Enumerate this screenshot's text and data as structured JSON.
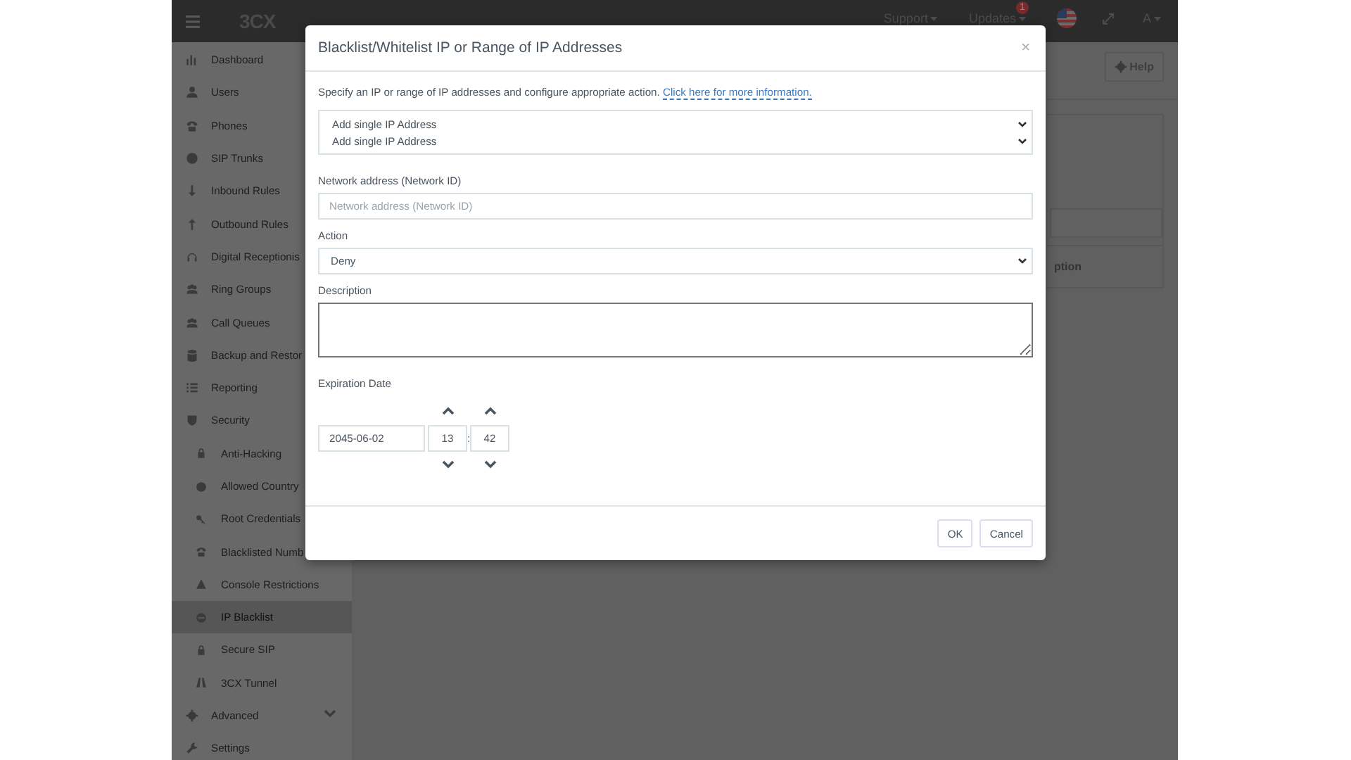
{
  "topbar": {
    "logo": "3CX",
    "support": "Support",
    "updates": {
      "label": "Updates",
      "badge": "1"
    },
    "user": "A"
  },
  "sidebar": {
    "items": [
      {
        "label": "Dashboard",
        "selected": false
      },
      {
        "label": "Users",
        "selected": false
      },
      {
        "label": "Phones",
        "selected": false
      },
      {
        "label": "SIP Trunks",
        "selected": false
      },
      {
        "label": "Inbound Rules",
        "selected": false
      },
      {
        "label": "Outbound Rules",
        "selected": false
      },
      {
        "label": "Digital Receptionis",
        "selected": false
      },
      {
        "label": "Ring Groups",
        "selected": false
      },
      {
        "label": "Call Queues",
        "selected": false
      },
      {
        "label": "Backup and Restor",
        "selected": false
      },
      {
        "label": "Reporting",
        "selected": false
      },
      {
        "label": "Security",
        "selected": false,
        "expanded": true,
        "children": [
          {
            "label": "Anti-Hacking",
            "selected": false
          },
          {
            "label": "Allowed Country",
            "selected": false
          },
          {
            "label": "Root Credentials",
            "selected": false
          },
          {
            "label": "Blacklisted Numb",
            "selected": false
          },
          {
            "label": "Console Restrictions",
            "selected": false
          },
          {
            "label": "IP Blacklist",
            "selected": true
          },
          {
            "label": "Secure SIP",
            "selected": false
          },
          {
            "label": "3CX Tunnel",
            "selected": false
          }
        ]
      },
      {
        "label": "Advanced",
        "selected": false,
        "expanded": false
      },
      {
        "label": "Settings",
        "selected": false
      }
    ]
  },
  "content": {
    "help_button": "Help",
    "column_fragment": "ption"
  },
  "dialog": {
    "title": "Blacklist/Whitelist IP or Range of IP Addresses",
    "close": "×",
    "intro": "Specify an IP or range of IP addresses and configure appropriate action.",
    "intro_link": "Click here for more information.",
    "type_selects": [
      "Add single IP Address",
      "Add single IP Address"
    ],
    "network": {
      "label": "Network address (Network ID)",
      "placeholder": "Network address (Network ID)"
    },
    "action": {
      "label": "Action",
      "value": "Deny"
    },
    "description": {
      "label": "Description"
    },
    "expiration": {
      "label": "Expiration Date",
      "date": "2045-06-02",
      "hour": "13",
      "separator": ":",
      "minute": "42"
    },
    "buttons": [
      "OK",
      "Cancel"
    ]
  }
}
